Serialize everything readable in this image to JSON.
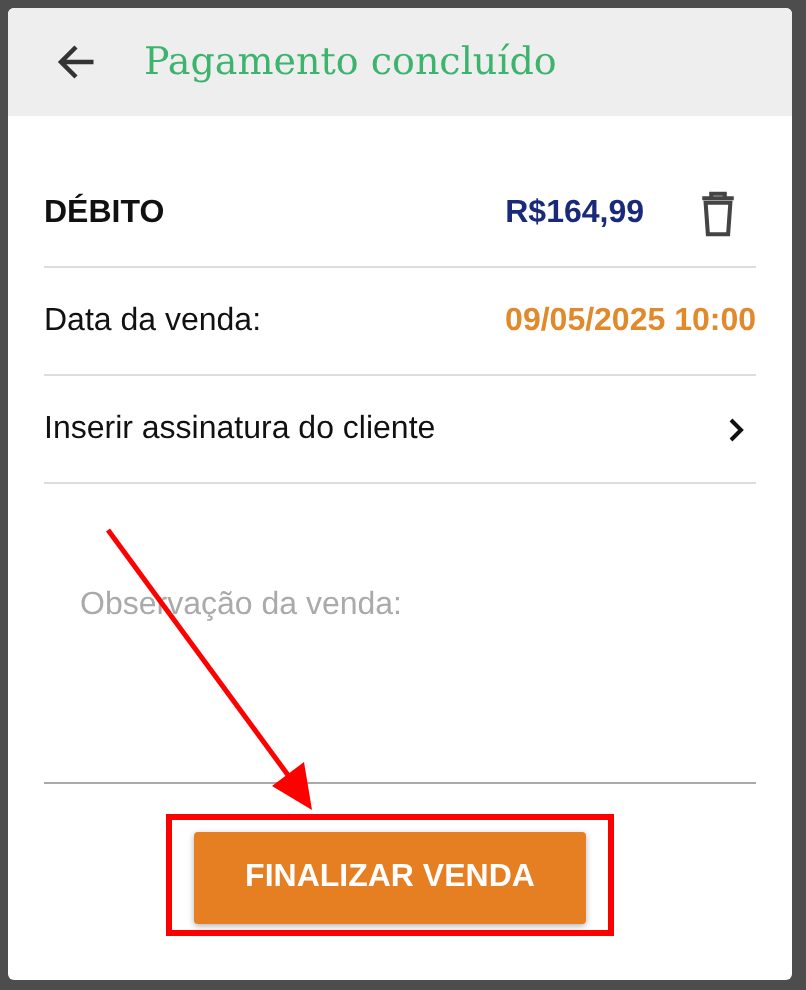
{
  "dialog": {
    "title": "Pagamento concluído",
    "payment": {
      "method": "DÉBITO",
      "amount": "R$164,99"
    },
    "sale_date": {
      "label": "Data da venda:",
      "value": "09/05/2025 10:00"
    },
    "signature": {
      "label": "Inserir assinatura do cliente"
    },
    "notes": {
      "placeholder": "Observação da venda:"
    },
    "button": {
      "label": "FINALIZAR VENDA"
    }
  }
}
